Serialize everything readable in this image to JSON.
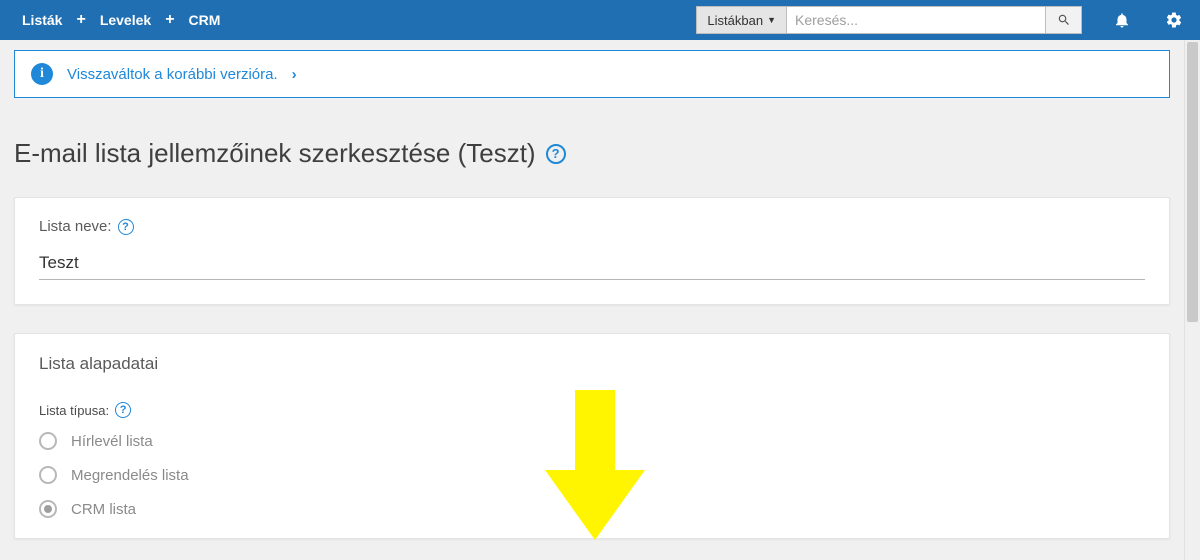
{
  "topbar": {
    "nav": {
      "lists": "Listák",
      "letters": "Levelek",
      "crm": "CRM"
    },
    "search": {
      "scope": "Listákban",
      "placeholder": "Keresés..."
    }
  },
  "banner": {
    "text": "Visszaváltok a korábbi verzióra."
  },
  "page_title": "E-mail lista jellemzőinek szerkesztése (Teszt)",
  "list_name": {
    "label": "Lista neve:",
    "value": "Teszt"
  },
  "basics": {
    "heading": "Lista alapadatai",
    "type_label": "Lista típusa:",
    "options": [
      {
        "label": "Hírlevél lista"
      },
      {
        "label": "Megrendelés lista"
      },
      {
        "label": "CRM lista"
      }
    ],
    "selected_index": 2
  }
}
